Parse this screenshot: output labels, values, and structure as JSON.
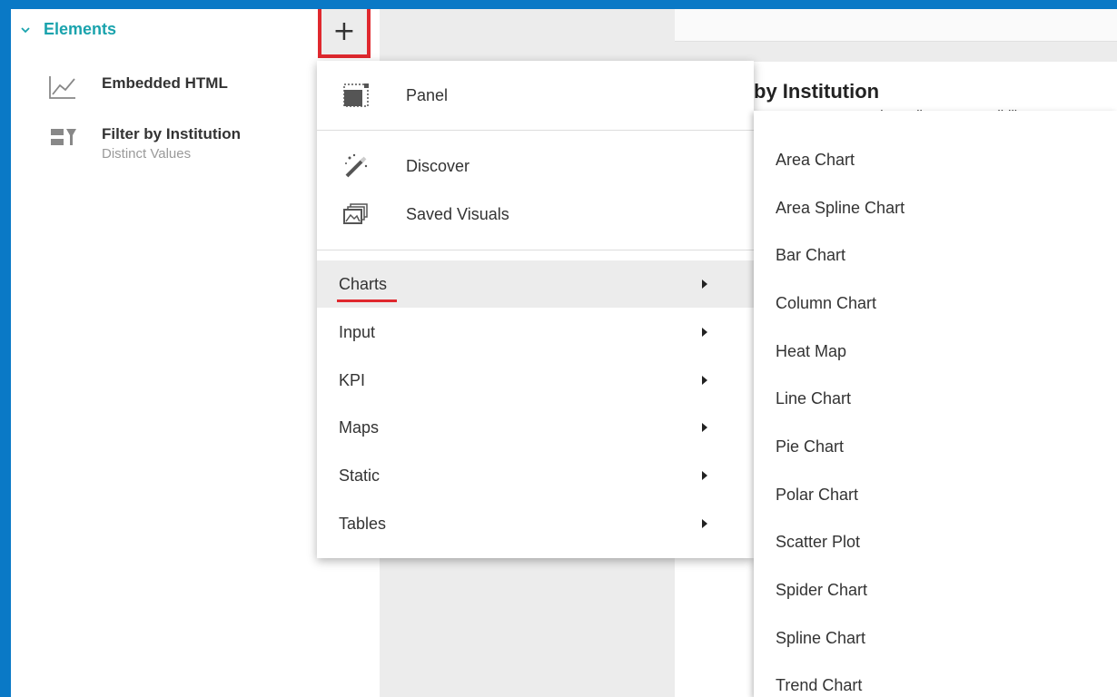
{
  "sidebar": {
    "section_title": "Elements",
    "items": [
      {
        "title": "Embedded HTML",
        "subtitle": "",
        "icon": "line-chart-icon"
      },
      {
        "title": "Filter by Institution",
        "subtitle": "Distinct Values",
        "icon": "filter-icon"
      }
    ]
  },
  "add_button": {
    "label": "+"
  },
  "canvas": {
    "panel_title": "by Institution",
    "panel_subtitle": "…mance CC, Central Carolina CC, Sandhills CC, …"
  },
  "menu": {
    "items": [
      {
        "label": "Panel",
        "icon": "panel-icon"
      },
      {
        "label": "Discover",
        "icon": "magic-wand-icon"
      },
      {
        "label": "Saved Visuals",
        "icon": "saved-visuals-icon"
      }
    ],
    "submenus": [
      {
        "label": "Charts",
        "active": true
      },
      {
        "label": "Input"
      },
      {
        "label": "KPI"
      },
      {
        "label": "Maps"
      },
      {
        "label": "Static"
      },
      {
        "label": "Tables"
      }
    ]
  },
  "charts_submenu": {
    "items": [
      "Area Chart",
      "Area Spline Chart",
      "Bar Chart",
      "Column Chart",
      "Heat Map",
      "Line Chart",
      "Pie Chart",
      "Polar Chart",
      "Scatter Plot",
      "Spider Chart",
      "Spline Chart",
      "Trend Chart"
    ]
  },
  "colors": {
    "frame": "#0a79c6",
    "accent_teal": "#1aa3ad",
    "highlight_red": "#e0282e"
  }
}
